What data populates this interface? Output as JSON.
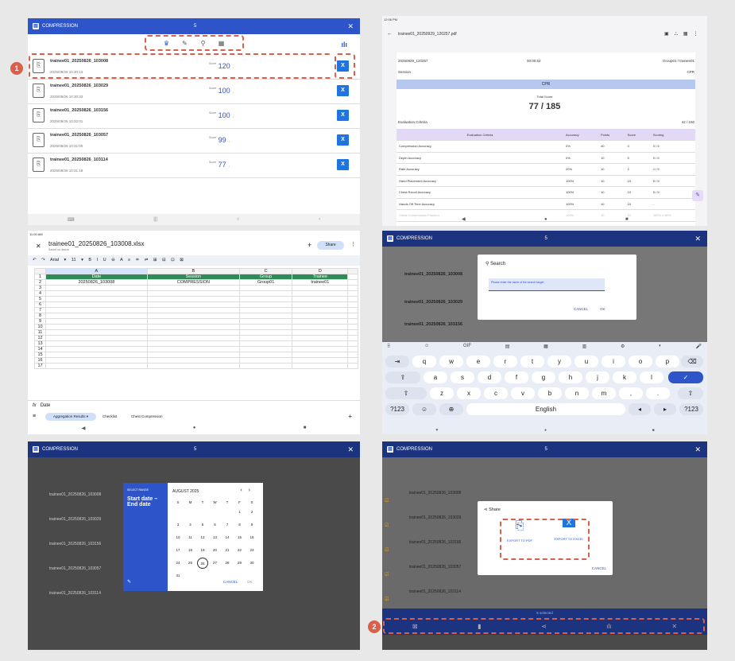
{
  "app": {
    "title": "COMPRESSION",
    "count": "5",
    "close": "✕"
  },
  "toolbar": {
    "crown": "♛",
    "pen": "✎",
    "search": "⚲",
    "calendar": "▦",
    "chart": "ılı"
  },
  "records": [
    {
      "name": "trainee01_20250826_103008",
      "date": "2025/08/26 10:30:13",
      "score_label": "Score",
      "score": "120",
      "flag": "↓"
    },
    {
      "name": "trainee01_20250826_103029",
      "date": "2025/08/26 10:30:33",
      "score_label": "Score",
      "score": "100",
      "flag": "↓"
    },
    {
      "name": "trainee01_20250826_103156",
      "date": "2025/08/26 10:32:01",
      "score_label": "Score",
      "score": "100",
      "flag": "↓"
    },
    {
      "name": "trainee01_20250826_103057",
      "date": "2025/08/26 10:31:00",
      "score_label": "Score",
      "score": "99",
      "flag": "↓"
    },
    {
      "name": "trainee01_20250826_103114",
      "date": "2025/08/26 10:31:18",
      "score_label": "Score",
      "score": "77",
      "flag": "↓"
    }
  ],
  "badges": {
    "one": "1",
    "two": "2"
  },
  "pdf": {
    "status_time": "12:06 PM",
    "filename": "trainee01_20250929_120257.pdf",
    "date": "20250929_120257",
    "duration": "00:00:52",
    "group": "Group01 / trainee01",
    "session_label": "Session",
    "session_value": "CPR",
    "section": "CPR",
    "total_label": "Total Score",
    "total": "77 / 185",
    "criteria_label": "Evaluation Criteria",
    "criteria_score": "42 / 150",
    "table_head": [
      "Evaluation Criteria",
      "Accuracy",
      "Points",
      "Score",
      "Scoring"
    ],
    "table_rows": [
      [
        "Compression Accuracy",
        "0%",
        "40",
        "0",
        "0 / 5"
      ],
      [
        "Depth Accuracy",
        "0%",
        "10",
        "0",
        "0 / 5"
      ],
      [
        "Rate Accuracy",
        "20%",
        "10",
        "2",
        "1 / 5"
      ],
      [
        "Hand Placement Accuracy",
        "100%",
        "10",
        "10",
        "5 / 5"
      ],
      [
        "Chest Recoil Accuracy",
        "100%",
        "10",
        "10",
        "5 / 5"
      ],
      [
        "Hands Off Time Accuracy",
        "100%",
        "10",
        "10",
        "-"
      ],
      [
        "Chest Compression Fraction",
        "100%",
        "10",
        "10",
        "100% ≥ 80%"
      ]
    ]
  },
  "sheet": {
    "status_time": "11:00 AM",
    "filename": "trainee01_20250826_103008.xlsx",
    "saved": "Saved on device",
    "share": "Share",
    "font": "Arial",
    "size": "11",
    "cols": [
      "A",
      "B",
      "C",
      "D"
    ],
    "headers": [
      "Date",
      "Session",
      "Group",
      "Trainee"
    ],
    "row": [
      "20250826_103008",
      "COMPRESSION",
      "Group01",
      "trainee01"
    ],
    "formula_fx": "fx",
    "formula": "Date",
    "tabs": [
      "Aggregation Results",
      "Checklist",
      "Chest Compression"
    ]
  },
  "search": {
    "title": "Search",
    "placeholder": "Please enter the name of the search target",
    "cancel": "CANCEL",
    "ok": "OK",
    "lang": "English",
    "row1": [
      "q",
      "w",
      "e",
      "r",
      "t",
      "y",
      "u",
      "i",
      "o",
      "p"
    ],
    "row1num": [
      "1",
      "2",
      "3",
      "4",
      "5",
      "6",
      "7",
      "8",
      "9",
      "0"
    ],
    "row2": [
      "a",
      "s",
      "d",
      "f",
      "g",
      "h",
      "j",
      "k",
      "l"
    ],
    "row3": [
      "z",
      "x",
      "c",
      "v",
      "b",
      "n",
      "m",
      ",",
      "."
    ],
    "num": "?123",
    "gif": "GIF"
  },
  "date": {
    "select": "SELECT RANGE",
    "range": "Start date – End date",
    "month": "AUGUST 2025",
    "dow": [
      "S",
      "M",
      "T",
      "W",
      "T",
      "F",
      "S"
    ],
    "days": [
      "",
      "",
      "",
      "",
      "",
      "1",
      "2",
      "3",
      "4",
      "5",
      "6",
      "7",
      "8",
      "9",
      "10",
      "11",
      "12",
      "13",
      "14",
      "15",
      "16",
      "17",
      "18",
      "19",
      "20",
      "21",
      "22",
      "23",
      "24",
      "25",
      "26",
      "27",
      "28",
      "29",
      "30",
      "31"
    ],
    "selected": "26",
    "cancel": "CANCEL",
    "ok": "OK"
  },
  "share": {
    "title": "Share",
    "pdf": "EXPORT TO PDF",
    "excel": "EXPORT TO EXCEL",
    "cancel": "CANCEL",
    "selected": "5 selected"
  }
}
